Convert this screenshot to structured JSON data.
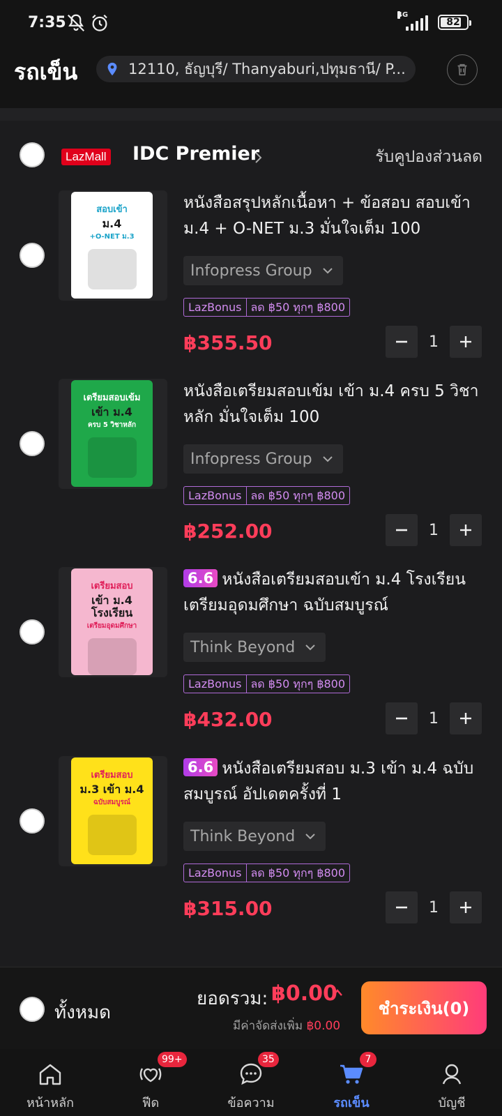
{
  "status_bar": {
    "time": "7:35",
    "network": "4G",
    "battery": "82",
    "battery_level_percent": 82,
    "icons": [
      "notifications-off-icon",
      "alarm-icon",
      "signal-icon",
      "battery-icon"
    ]
  },
  "header": {
    "title": "รถเข็น",
    "address": "12110, ธัญบุรี/ Thanyaburi,ปทุมธานี/ P...",
    "icons": [
      "location-pin-icon",
      "trash-icon"
    ]
  },
  "shop": {
    "badge": "LazMall",
    "name": "IDC Premier",
    "coupon_link": "รับคูปองส่วนลด",
    "selected": false
  },
  "items": [
    {
      "promo_tag": "",
      "title": "หนังสือสรุปหลักเนื้อหา + ข้อสอบ สอบเข้า ม.4 + O-NET ม.3 มั่นใจเต็ม 100",
      "variant": "Infopress Group",
      "bonus_label": "LazBonus",
      "bonus_detail": "ลด ฿50 ทุกๆ ฿800",
      "price": "฿355.50",
      "quantity": "1",
      "selected": false,
      "cover": {
        "line1": "สอบเข้า",
        "line2": "ม.4",
        "line3": "+O-NET ม.3",
        "bg": "#ffffff",
        "accent": "#1aa3c9"
      }
    },
    {
      "promo_tag": "",
      "title": "หนังสือเตรียมสอบเข้ม เข้า ม.4 ครบ 5 วิชาหลัก มั่นใจเต็ม 100",
      "variant": "Infopress Group",
      "bonus_label": "LazBonus",
      "bonus_detail": "ลด ฿50 ทุกๆ ฿800",
      "price": "฿252.00",
      "quantity": "1",
      "selected": false,
      "cover": {
        "line1": "เตรียมสอบเข้ม",
        "line2": "เข้า ม.4",
        "line3": "ครบ 5 วิชาหลัก",
        "bg": "#1fa84a",
        "accent": "#ffffff"
      }
    },
    {
      "promo_tag": "6.6",
      "title": "หนังสือเตรียมสอบเข้า ม.4 โรงเรียนเตรียมอุดมศึกษา ฉบับสมบูรณ์",
      "variant": "Think Beyond",
      "bonus_label": "LazBonus",
      "bonus_detail": "ลด ฿50 ทุกๆ ฿800",
      "price": "฿432.00",
      "quantity": "1",
      "selected": false,
      "cover": {
        "line1": "เตรียมสอบ",
        "line2": "เข้า ม.4 โรงเรียน",
        "line3": "เตรียมอุดมศึกษา",
        "bg": "#f5b7cf",
        "accent": "#e0205a"
      }
    },
    {
      "promo_tag": "6.6",
      "title": "หนังสือเตรียมสอบ ม.3 เข้า ม.4 ฉบับสมบูรณ์ อัปเดตครั้งที่ 1",
      "variant": "Think Beyond",
      "bonus_label": "LazBonus",
      "bonus_detail": "ลด ฿50 ทุกๆ ฿800",
      "price": "฿315.00",
      "quantity": "1",
      "selected": false,
      "cover": {
        "line1": "เตรียมสอบ",
        "line2": "ม.3 เข้า ม.4",
        "line3": "ฉบับสมบูรณ์",
        "bg": "#ffe11a",
        "accent": "#e0205a"
      }
    }
  ],
  "checkout": {
    "select_all_label": "ทั้งหมด",
    "total_label": "ยอดรวม:",
    "total_value": "฿0.00",
    "shipping_label": "มีค่าจัดส่งเพิ่ม",
    "shipping_value": "฿0.00",
    "pay_button": "ชำระเงิน(0)"
  },
  "nav": [
    {
      "label": "หน้าหลัก",
      "icon": "home-icon",
      "badge": "",
      "active": false
    },
    {
      "label": "ฟีด",
      "icon": "feed-icon",
      "badge": "99+",
      "active": false
    },
    {
      "label": "ข้อความ",
      "icon": "chat-icon",
      "badge": "35",
      "active": false
    },
    {
      "label": "รถเข็น",
      "icon": "cart-icon",
      "badge": "7",
      "active": true
    },
    {
      "label": "บัญชี",
      "icon": "account-icon",
      "badge": "",
      "active": false
    }
  ],
  "colors": {
    "background": "#1c1c1e",
    "price": "#ff3d5a",
    "accent_blue": "#5b8cff",
    "lazmall_red": "#e0001b",
    "bonus_purple": "#b06bd8"
  }
}
